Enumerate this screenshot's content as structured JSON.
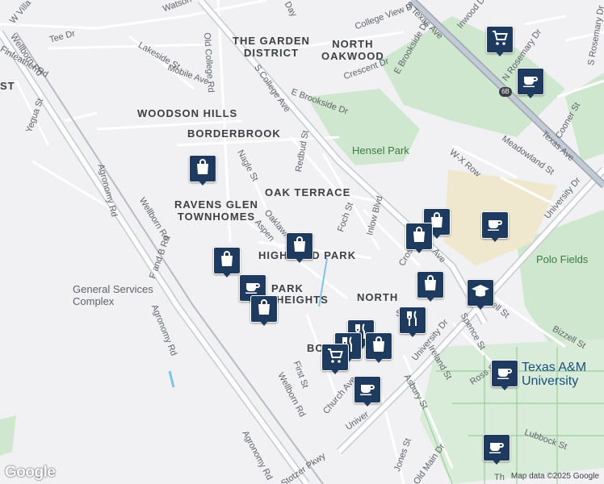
{
  "map": {
    "attribution": "Map data ©2025 Google",
    "logo": "Google",
    "areas": {
      "garden": "THE GARDEN\nDISTRICT",
      "north_oakwood": "NORTH\nOAKWOOD",
      "woodson": "WOODSON HILLS",
      "borderbrook": "BORDERBROOK",
      "oak_terrace": "OAK TERRACE",
      "ravens": "RAVENS GLEN\nTOWNHOMES",
      "highland": "HIGHLAND PARK",
      "park": "PARK",
      "heights": "HEIGHTS",
      "north_gate": "NORTH",
      "bo": "BO",
      "st": "ST"
    },
    "places": {
      "hensel": "Hensel Park",
      "polo": "Polo Fields",
      "gsc": "General Services\nComplex",
      "tamu": "Texas A&M\nUniversity"
    },
    "shield": "6B",
    "streets": {
      "watson": "Watson",
      "day": "Day",
      "college_view": "College View D",
      "s_texas": "S Texas Ave",
      "inwood": "Inwood Dr",
      "s_rosemary": "S Rosemary Dr",
      "n_rosemary": "N Rosemary Dr",
      "tee": "Tee Dr",
      "w_villa": "W Villa",
      "wellborn1": "Wellborn Rd",
      "finfeather": "Finfeather Rd",
      "yegua": "Yegua St",
      "lakeside": "Lakeside St",
      "mobile": "Mobile Ave",
      "old_college": "Old College Rd",
      "s_college": "S College Ave",
      "e_brookside": "E Brookside Dr",
      "e_brookside2": "E Brookside Dr",
      "crescent": "Crescent Dr",
      "cooner": "Cooner St",
      "texas_ave": "Texas Ave",
      "meadowland": "Meadowland St",
      "wx_row": "W-X Row",
      "university": "University Dr",
      "nagle": "Nagle St",
      "redbud": "Redbud St",
      "agronomy1": "Agronomy Rd",
      "wellborn2": "Wellborn Rd",
      "oaklawn": "Oaklawn",
      "aspen": "Aspen",
      "foch": "Foch St",
      "inlow": "Inlow Blvd",
      "cross": "Cross",
      "college_ave": "Ave",
      "f_and_b": "F and B Rd",
      "agronomy2": "Agronomy Rd",
      "spence": "Spence St",
      "bizzell": "Bizzell St",
      "ell": "ell St",
      "university_dr": "University Dr",
      "ireland": "Ireland St",
      "asbury": "Asbury St",
      "first": "First St",
      "church": "Church Ave",
      "wellborn3": "Wellborn Rd",
      "univer": "Univer",
      "ross": "Ross St",
      "lubbock": "Lubbock St",
      "jones": "Jones St",
      "old_main": "Old Main Dr",
      "agronomy3": "Agronomy Rd",
      "stotzer": "Stotzer Pkwy",
      "th": "Th",
      "st_near": "St"
    },
    "markers": [
      {
        "id": "grocery-1",
        "icon": "cart"
      },
      {
        "id": "cafe-1",
        "icon": "cup"
      },
      {
        "id": "shop-1",
        "icon": "bag"
      },
      {
        "id": "shop-2",
        "icon": "bag"
      },
      {
        "id": "shop-3",
        "icon": "bag"
      },
      {
        "id": "cafe-2",
        "icon": "cup"
      },
      {
        "id": "shop-4",
        "icon": "bag"
      },
      {
        "id": "cafe-3",
        "icon": "cup"
      },
      {
        "id": "shop-5",
        "icon": "bag"
      },
      {
        "id": "shop-6",
        "icon": "bag"
      },
      {
        "id": "school",
        "icon": "cap"
      },
      {
        "id": "shop-7",
        "icon": "bag"
      },
      {
        "id": "food-1",
        "icon": "fork"
      },
      {
        "id": "food-2",
        "icon": "fork"
      },
      {
        "id": "food-3",
        "icon": "fork"
      },
      {
        "id": "shop-8",
        "icon": "bag"
      },
      {
        "id": "grocery-2",
        "icon": "cart"
      },
      {
        "id": "cafe-4",
        "icon": "cup"
      },
      {
        "id": "cafe-5",
        "icon": "cup"
      },
      {
        "id": "cafe-6",
        "icon": "cup"
      }
    ]
  }
}
